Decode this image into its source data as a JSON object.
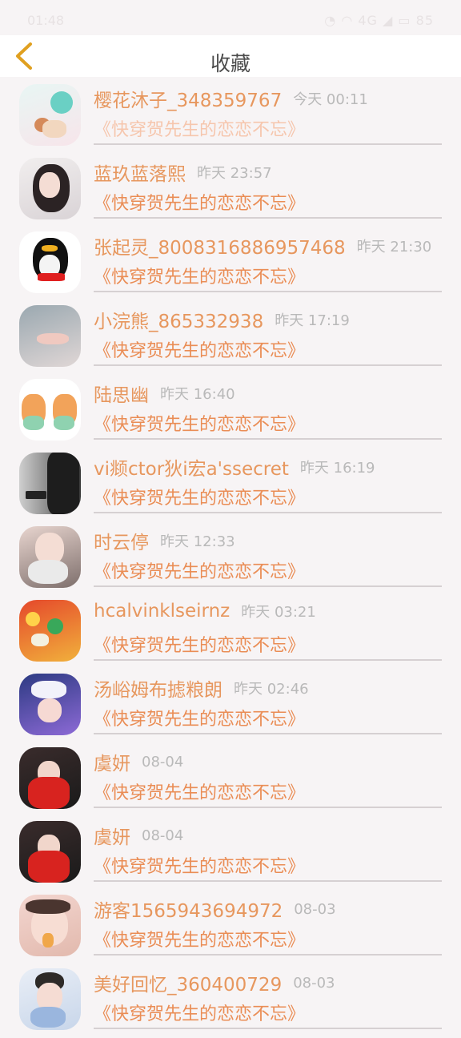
{
  "status_bar": {
    "time": "01:48",
    "indicators": "◔ ◠ 4G ◢ ▭ 85"
  },
  "header": {
    "back_icon": "chevron-left-icon",
    "title": "收藏"
  },
  "colors": {
    "name": "#e7975e",
    "book": "#ea8d55",
    "time": "#b9b9b9",
    "divider": "#d6d0d2",
    "back": "#e0a020"
  },
  "items": [
    {
      "name": "樱花沐子_348359767",
      "time": "今天 00:11",
      "book": "《快穿贺先生的恋恋不忘》",
      "faded": true
    },
    {
      "name": "蓝玖蓝落熙",
      "time": "昨天 23:57",
      "book": "《快穿贺先生的恋恋不忘》"
    },
    {
      "name": "张起灵_8008316886957468",
      "time": "昨天 21:30",
      "book": "《快穿贺先生的恋恋不忘》"
    },
    {
      "name": "小浣熊_865332938",
      "time": "昨天 17:19",
      "book": "《快穿贺先生的恋恋不忘》"
    },
    {
      "name": "陆思幽",
      "time": "昨天 16:40",
      "book": "《快穿贺先生的恋恋不忘》"
    },
    {
      "name": "vi𫖯ctor狄i宏a'ssecret",
      "time": "昨天 16:19",
      "book": "《快穿贺先生的恋恋不忘》"
    },
    {
      "name": "时云停",
      "time": "昨天 12:33",
      "book": "《快穿贺先生的恋恋不忘》"
    },
    {
      "name": "hcalvinklseirnz",
      "time": "昨天 03:21",
      "book": "《快穿贺先生的恋恋不忘》"
    },
    {
      "name": "汤峪姆布摅粮朗",
      "time": "昨天 02:46",
      "book": "《快穿贺先生的恋恋不忘》"
    },
    {
      "name": "虞妍",
      "time": "08-04",
      "book": "《快穿贺先生的恋恋不忘》"
    },
    {
      "name": "虞妍",
      "time": "08-04",
      "book": "《快穿贺先生的恋恋不忘》"
    },
    {
      "name": "游客1565943694972",
      "time": "08-03",
      "book": "《快穿贺先生的恋恋不忘》"
    },
    {
      "name": "美好回忆_360400729",
      "time": "08-03",
      "book": "《快穿贺先生的恋恋不忘》"
    }
  ]
}
